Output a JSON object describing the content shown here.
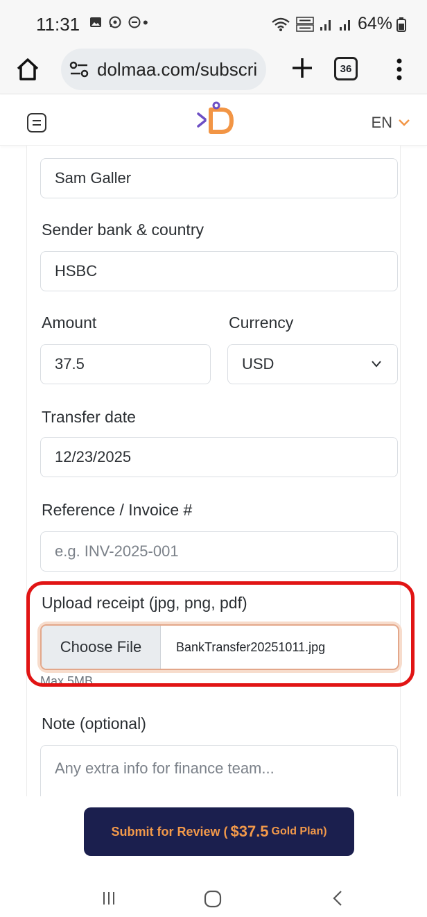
{
  "status_bar": {
    "time": "11:31",
    "dot": "•",
    "battery": "64%"
  },
  "browser": {
    "url": "dolmaa.com/subscri",
    "tab_count": "36"
  },
  "header": {
    "language": "EN"
  },
  "form": {
    "name_value": "Sam Galler",
    "bank_label": "Sender bank & country",
    "bank_value": "HSBC",
    "amount_label": "Amount",
    "amount_value": "37.5",
    "currency_label": "Currency",
    "currency_value": "USD",
    "date_label": "Transfer date",
    "date_value": "12/23/2025",
    "reference_label": "Reference / Invoice #",
    "reference_placeholder": "e.g. INV-2025-001",
    "upload_label": "Upload receipt (jpg, png, pdf)",
    "choose_file": "Choose File",
    "file_name": "BankTransfer20251011.jpg",
    "upload_hint": "Max 5MB",
    "note_label": "Note (optional)",
    "note_placeholder": "Any extra info for finance team..."
  },
  "submit": {
    "prefix": "Submit for Review (",
    "amount": "$37.5",
    "plan": "Gold Plan)"
  },
  "colors": {
    "accent": "#f2994a",
    "button_bg": "#1b1f4e",
    "highlight": "#e11414"
  }
}
